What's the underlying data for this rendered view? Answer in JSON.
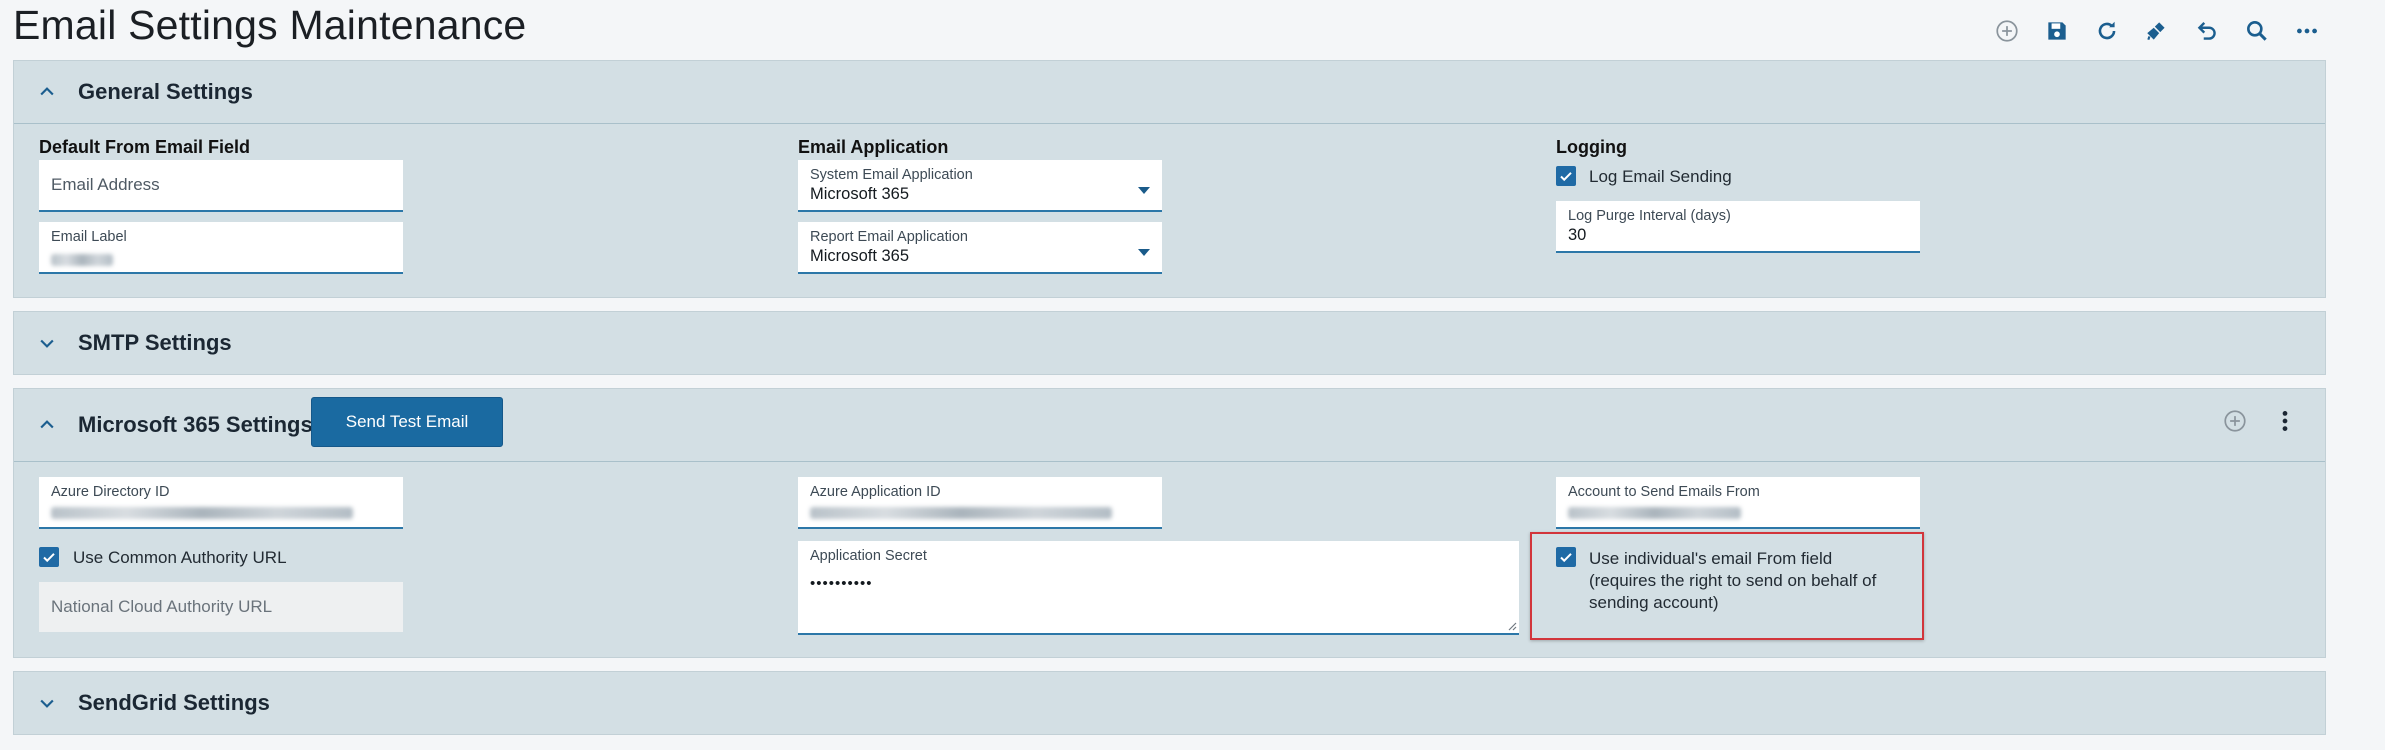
{
  "header": {
    "title": "Email Settings Maintenance",
    "toolbar": [
      {
        "icon": "add-icon"
      },
      {
        "icon": "save-icon"
      },
      {
        "icon": "refresh-icon"
      },
      {
        "icon": "clear-icon"
      },
      {
        "icon": "undo-icon"
      },
      {
        "icon": "search-icon"
      },
      {
        "icon": "more-horizontal-icon"
      }
    ]
  },
  "colors": {
    "accent": "#1f6aa5",
    "panel_bg": "#d3dfe4",
    "highlight": "#d2353b"
  },
  "general": {
    "title": "General Settings",
    "default_from": {
      "heading": "Default From Email Field",
      "email_placeholder": "Email Address",
      "email_label_label": "Email Label",
      "email_label_value": ""
    },
    "email_app": {
      "heading": "Email Application",
      "system_label": "System Email Application",
      "system_value": "Microsoft 365",
      "report_label": "Report Email Application",
      "report_value": "Microsoft 365"
    },
    "logging": {
      "heading": "Logging",
      "log_sending_label": "Log Email Sending",
      "log_sending_checked": true,
      "purge_label": "Log Purge Interval (days)",
      "purge_value": "30"
    }
  },
  "smtp": {
    "title": "SMTP Settings"
  },
  "ms365": {
    "title": "Microsoft 365 Settings",
    "send_test_label": "Send Test Email",
    "azure_directory_label": "Azure Directory ID",
    "azure_application_label": "Azure Application ID",
    "account_label": "Account to Send Emails From",
    "common_authority_label": "Use Common Authority URL",
    "common_authority_checked": true,
    "national_cloud_placeholder": "National Cloud Authority URL",
    "app_secret_label": "Application Secret",
    "app_secret_value": "••••••••••",
    "individual_from_label": "Use individual's email From field (requires the right to send on behalf of sending account)",
    "individual_from_checked": true
  },
  "sendgrid": {
    "title": "SendGrid Settings"
  }
}
